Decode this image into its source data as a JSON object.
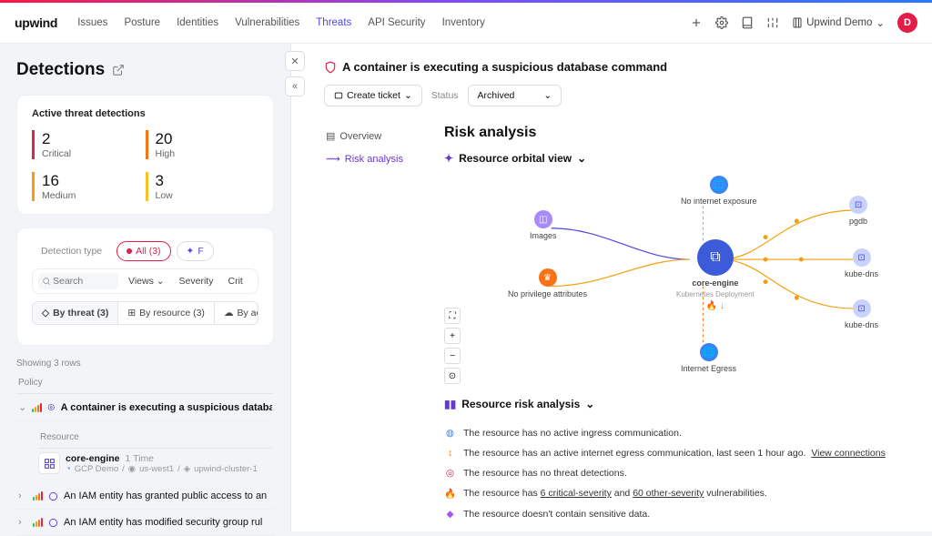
{
  "brand": "upwind",
  "nav": {
    "items": [
      "Issues",
      "Posture",
      "Identities",
      "Vulnerabilities",
      "Threats",
      "API Security",
      "Inventory"
    ],
    "activeIndex": 4
  },
  "orgSwitcher": "Upwind Demo",
  "avatarLetter": "D",
  "leftPane": {
    "title": "Detections",
    "cardTitle": "Active threat detections",
    "metrics": [
      {
        "count": "2",
        "label": "Critical",
        "sev": "critical"
      },
      {
        "count": "20",
        "label": "High",
        "sev": "high"
      },
      {
        "count": "16",
        "label": "Medium",
        "sev": "medium"
      },
      {
        "count": "3",
        "label": "Low",
        "sev": "low"
      }
    ],
    "filters": {
      "detectionTypeLabel": "Detection type",
      "allChip": "All (3)",
      "otherChip": "F"
    },
    "search": {
      "placeholder": "Search",
      "views": "Views",
      "severity": "Severity",
      "criticality": "Crit"
    },
    "tabs": [
      {
        "label": "By threat (3)",
        "active": true
      },
      {
        "label": "By resource (3)",
        "active": false
      },
      {
        "label": "By ac",
        "active": false
      }
    ],
    "rowsText": "Showing 3 rows",
    "policyHeader": "Policy",
    "resourceHeader": "Resource",
    "rows": [
      {
        "expanded": true,
        "text": "A container is executing a suspicious database command"
      },
      {
        "expanded": false,
        "text": "An IAM entity has granted public access to an"
      },
      {
        "expanded": false,
        "text": "An IAM entity has modified security group rul"
      }
    ],
    "resource": {
      "name": "core-engine",
      "times": "1 Time",
      "cloud": "GCP Demo",
      "region": "us-west1",
      "cluster": "upwind-cluster-1"
    }
  },
  "detail": {
    "title": "A container is executing a suspicious database command",
    "createTicket": "Create ticket",
    "statusLabel": "Status",
    "statusValue": "Archived",
    "sideTabs": {
      "overview": "Overview",
      "risk": "Risk analysis"
    },
    "riskTitle": "Risk analysis",
    "orbitalTitle": "Resource orbital view",
    "nodes": {
      "images": "Images",
      "npriv": "No privilege attributes",
      "nie": "No internet exposure",
      "core": "core-engine",
      "coreSub": "Kubernetes Deployment",
      "egress": "Internet Egress",
      "pgdb": "pgdb",
      "kubedns1": "kube-dns",
      "kubedns2": "kube-dns"
    },
    "resourceRiskTitle": "Resource risk analysis",
    "riskItems": [
      {
        "icon": "ingress",
        "text": "The resource has no active ingress communication."
      },
      {
        "icon": "egress",
        "textA": "The resource has an active internet egress communication, last seen 1 hour ago.",
        "link": "View connections"
      },
      {
        "icon": "threat",
        "text": "The resource has no threat detections."
      },
      {
        "icon": "vuln",
        "textA": "The resource has ",
        "link1": "6 critical-severity",
        "mid": " and ",
        "link2": "60 other-severity",
        "textB": " vulnerabilities."
      },
      {
        "icon": "data",
        "text": "The resource doesn't contain sensitive data."
      }
    ]
  }
}
